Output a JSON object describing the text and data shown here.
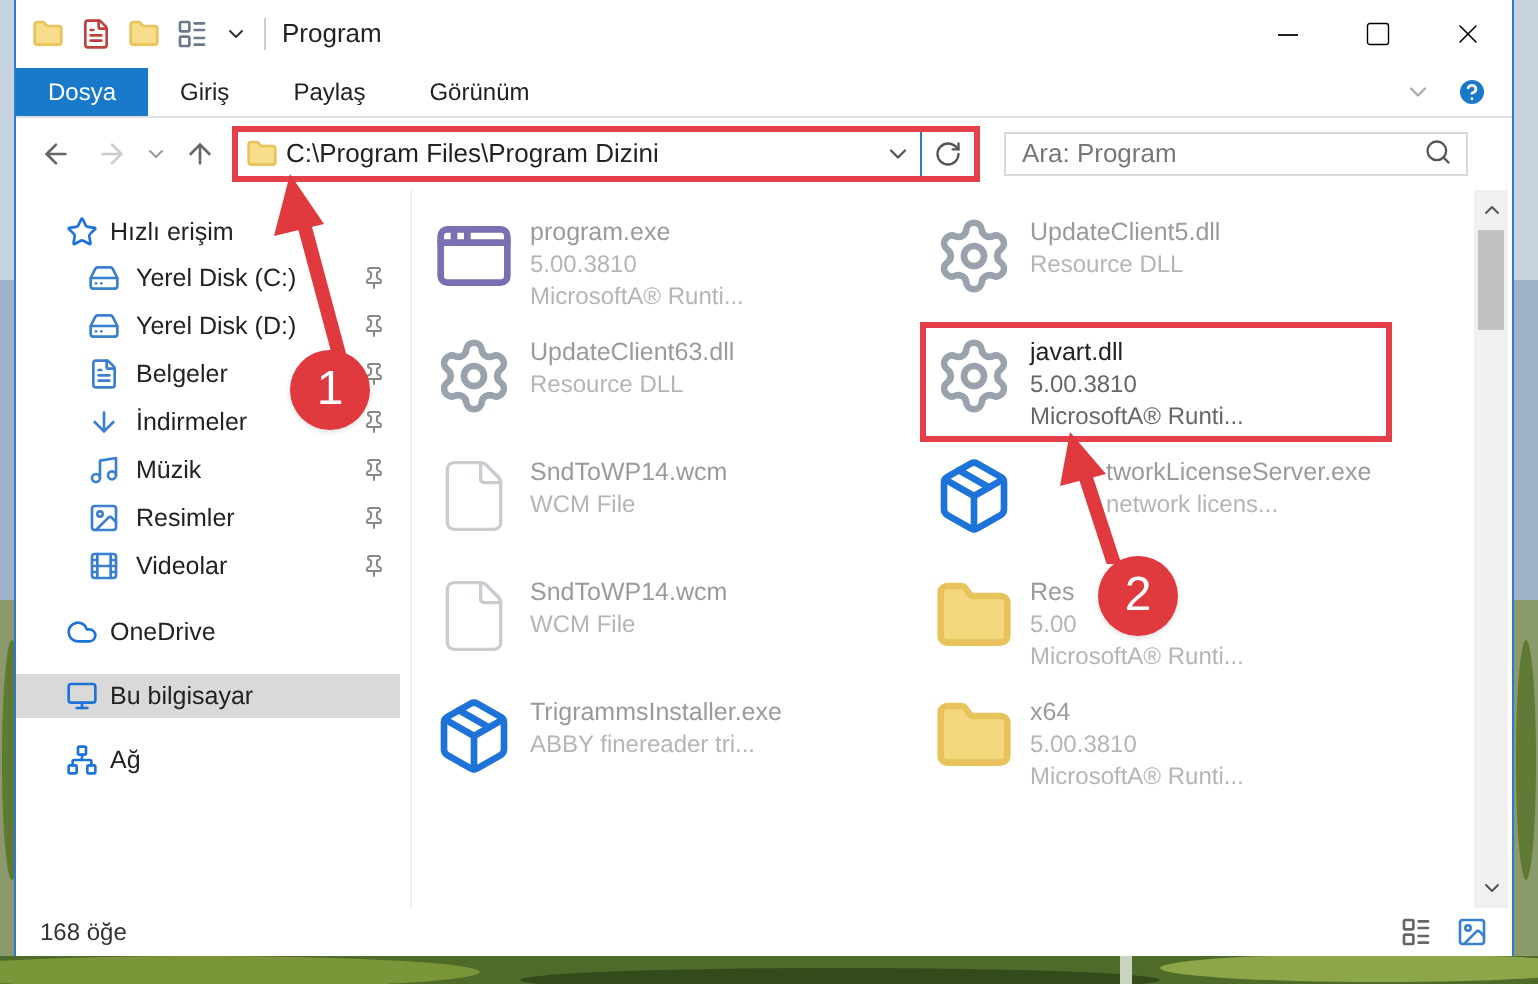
{
  "window": {
    "title": "Program"
  },
  "ribbon_tabs": [
    {
      "label": "Dosya",
      "kind": "file"
    },
    {
      "label": "Giriş",
      "kind": "tab"
    },
    {
      "label": "Paylaş",
      "kind": "tab"
    },
    {
      "label": "Görünüm",
      "kind": "tab"
    }
  ],
  "address_bar": {
    "path": "C:\\Program Files\\Program Dizini",
    "highlighted": true
  },
  "search": {
    "placeholder": "Ara: Program"
  },
  "sidebar": {
    "items": [
      {
        "label": "Hızlı erişim",
        "selected": false,
        "children": [
          {
            "label": "Yerel Disk (C:)",
            "pinned": true
          },
          {
            "label": "Yerel Disk (D:)",
            "pinned": true
          },
          {
            "label": "Belgeler",
            "pinned": true
          },
          {
            "label": "İndirmeler",
            "pinned": true
          },
          {
            "label": "Müzik",
            "pinned": true
          },
          {
            "label": "Resimler",
            "pinned": true
          },
          {
            "label": "Videolar",
            "pinned": true
          }
        ]
      },
      {
        "label": "OneDrive",
        "selected": false
      },
      {
        "label": "Bu bilgisayar",
        "selected": true
      },
      {
        "label": "Ağ",
        "selected": false
      }
    ]
  },
  "files": [
    {
      "name": "program.exe",
      "kind": "program",
      "lines": [
        {
          "text": "5.00.3810",
          "behind_arrow": false
        },
        {
          "text": "MicrosoftA® Runti...",
          "behind_arrow": false
        }
      ],
      "highlighted": false
    },
    {
      "name": "UpdateClient5.dll",
      "kind": "dll",
      "lines": [
        {
          "text": "Resource DLL",
          "behind_arrow": false
        }
      ],
      "highlighted": false
    },
    {
      "name": "UpdateClient63.dll",
      "kind": "dll",
      "lines": [
        {
          "text": "Resource DLL",
          "behind_arrow": false
        }
      ],
      "highlighted": false
    },
    {
      "name": "javart.dll",
      "kind": "dll",
      "lines": [
        {
          "text": "5.00.3810",
          "behind_arrow": false
        },
        {
          "text": "MicrosoftA® Runti...",
          "behind_arrow": false
        }
      ],
      "highlighted": true
    },
    {
      "name": "SndToWP14.wcm",
      "kind": "document",
      "lines": [
        {
          "text": "WCM File",
          "behind_arrow": false
        }
      ],
      "highlighted": false
    },
    {
      "name": "tworkLicenseServer.exe",
      "name_behind_arrow": true,
      "kind": "installer",
      "lines": [
        {
          "text": "network licens...",
          "behind_arrow": true
        }
      ],
      "highlighted": false
    },
    {
      "name": "SndToWP14.wcm",
      "kind": "document",
      "lines": [
        {
          "text": "WCM File",
          "behind_arrow": false
        }
      ],
      "highlighted": false
    },
    {
      "name": "Res",
      "kind": "folder",
      "lines": [
        {
          "text": "5.00",
          "behind_arrow": false
        },
        {
          "text": "MicrosoftA® Runti...",
          "behind_arrow": false
        }
      ],
      "highlighted": false
    },
    {
      "name": "TrigrammsInstaller.exe",
      "kind": "installer",
      "lines": [
        {
          "text": "ABBY finereader tri...",
          "behind_arrow": false
        }
      ],
      "highlighted": false
    },
    {
      "name": "x64",
      "kind": "folder",
      "lines": [
        {
          "text": "5.00.3810",
          "behind_arrow": false
        },
        {
          "text": "MicrosoftA® Runti...",
          "behind_arrow": false
        }
      ],
      "highlighted": false
    }
  ],
  "status_bar": {
    "count": "168 öğe"
  },
  "annotations": [
    {
      "number": "1"
    },
    {
      "number": "2"
    }
  ]
}
